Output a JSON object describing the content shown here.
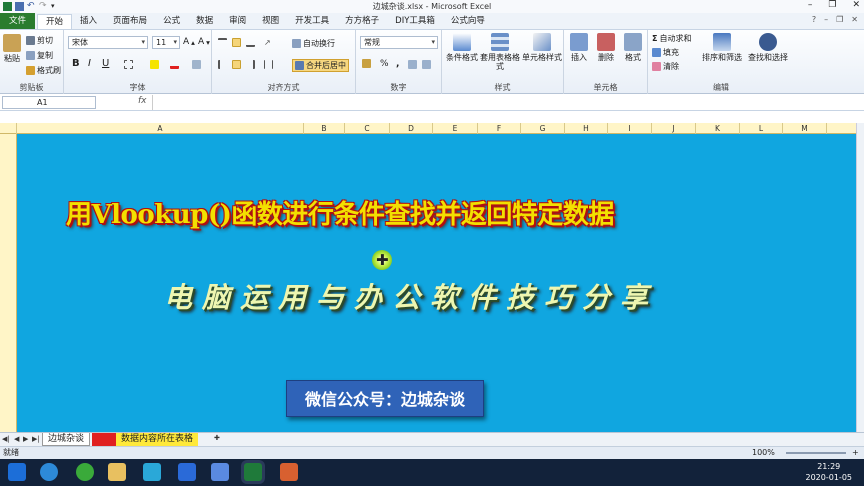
{
  "window": {
    "title": "边城杂谈.xlsx - Microsoft Excel"
  },
  "tabs": [
    {
      "label": "文件"
    },
    {
      "label": "开始"
    },
    {
      "label": "插入"
    },
    {
      "label": "页面布局"
    },
    {
      "label": "公式"
    },
    {
      "label": "数据"
    },
    {
      "label": "审阅"
    },
    {
      "label": "视图"
    },
    {
      "label": "开发工具"
    },
    {
      "label": "方方格子"
    },
    {
      "label": "DIY工具箱"
    },
    {
      "label": "公式向导"
    }
  ],
  "ribbon": {
    "clipboard": {
      "paste": "粘贴",
      "cut": "剪切",
      "copy": "复制",
      "format_painter": "格式刷",
      "label": "剪贴板"
    },
    "font": {
      "name": "宋体",
      "size": "11",
      "bold": "B",
      "italic": "I",
      "underline": "U",
      "label": "字体"
    },
    "alignment": {
      "wrap": "自动换行",
      "merge": "合并后居中",
      "label": "对齐方式"
    },
    "number": {
      "format": "常规",
      "percent": "%",
      "comma": ",",
      "label": "数字"
    },
    "styles": {
      "conditional": "条件格式",
      "table_format": "套用表格格式",
      "cell_style": "单元格样式",
      "label": "样式"
    },
    "cells": {
      "insert": "插入",
      "delete": "删除",
      "format": "格式",
      "label": "单元格"
    },
    "editing": {
      "autosum": "自动求和",
      "fill": "填充",
      "clear": "清除",
      "sort": "排序和筛选",
      "find": "查找和选择",
      "label": "编辑"
    }
  },
  "formula_bar": {
    "name_box": "A1",
    "fx": "fx",
    "formula": ""
  },
  "columns": [
    "A",
    "B",
    "C",
    "D",
    "E",
    "F",
    "G",
    "H",
    "I",
    "J",
    "K",
    "L",
    "M"
  ],
  "slide": {
    "title": "用Vlookup()函数进行条件查找并返回特定数据",
    "subtitle": "电脑运用与办公软件技巧分享",
    "wechat": "微信公众号：边城杂谈"
  },
  "sheet_tabs": [
    {
      "label": "边城杂谈"
    },
    {
      "label": "数据内容所在表格"
    }
  ],
  "status": {
    "ready": "就绪",
    "zoom": "100%"
  },
  "clock": {
    "time": "21:29",
    "date": "2020-01-05"
  },
  "colors": {
    "canvas": "#10a6e0",
    "title": "#f3e000",
    "file_tab": "#2a7c2e",
    "taskbar": "#12223a"
  }
}
